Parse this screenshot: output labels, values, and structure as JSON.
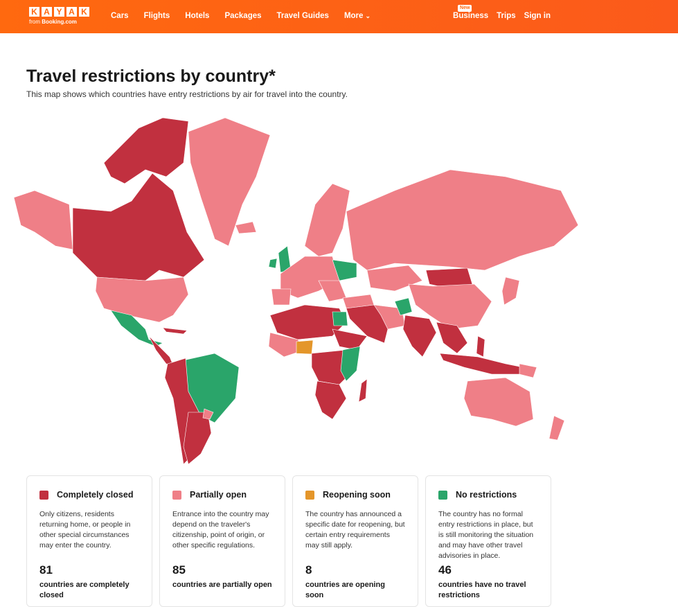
{
  "header": {
    "logo_letters": [
      "K",
      "A",
      "Y",
      "A",
      "K"
    ],
    "logo_from": "from",
    "logo_brand": "Booking.com",
    "nav": [
      "Cars",
      "Flights",
      "Hotels",
      "Packages",
      "Travel Guides",
      "More"
    ],
    "new_badge": "New",
    "business": "Business",
    "trips": "Trips",
    "sign_in": "Sign in"
  },
  "page": {
    "title": "Travel restrictions by country*",
    "subtitle": "This map shows which countries have entry restrictions by air for travel into the country."
  },
  "colors": {
    "closed": "#c1303f",
    "partial": "#ef7f87",
    "reopening": "#e4962a",
    "none": "#2aa56a",
    "nodata": "#e8e8e8",
    "brand": "#ff690f"
  },
  "legend": [
    {
      "key": "closed",
      "label": "Completely closed",
      "description": "Only citizens, residents returning home, or people in other special circumstances may enter the country.",
      "count": "81",
      "foot": "countries are completely closed"
    },
    {
      "key": "partial",
      "label": "Partially open",
      "description": "Entrance into the country may depend on the traveler's citizenship, point of origin, or other specific regulations.",
      "count": "85",
      "foot": "countries are partially open"
    },
    {
      "key": "reopening",
      "label": "Reopening soon",
      "description": "The country has announced a specific date for reopening, but certain entry requirements may still apply.",
      "count": "8",
      "foot": "countries are opening soon"
    },
    {
      "key": "none",
      "label": "No restrictions",
      "description": "The country has no formal entry restrictions in place, but is still monitoring the situation and may have other travel advisories in place.",
      "count": "46",
      "foot": "countries have no travel restrictions"
    }
  ]
}
